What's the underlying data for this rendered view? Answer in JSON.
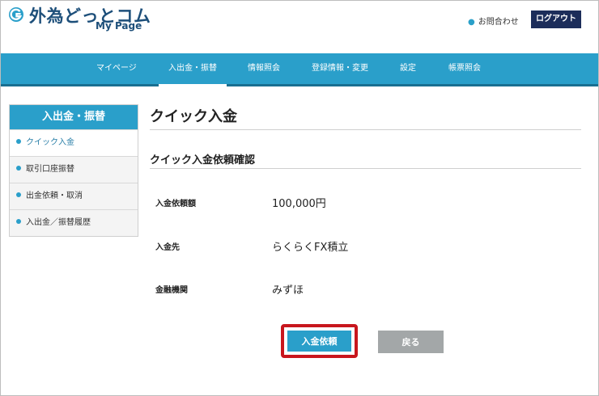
{
  "header": {
    "brand": "外為どっとコム",
    "brand_sub": "My Page",
    "contact_label": "お問合わせ",
    "logout_label": "ログアウト"
  },
  "nav": {
    "items": [
      {
        "label": "マイページ"
      },
      {
        "label": "入出金・振替",
        "active": true
      },
      {
        "label": "情報照会"
      },
      {
        "label": "登録情報・変更"
      },
      {
        "label": "設定"
      },
      {
        "label": "帳票照会"
      }
    ]
  },
  "sidebar": {
    "title": "入出金・振替",
    "items": [
      {
        "label": "クイック入金",
        "active": true
      },
      {
        "label": "取引口座振替"
      },
      {
        "label": "出金依頼・取消"
      },
      {
        "label": "入出金／振替履歴"
      }
    ]
  },
  "main": {
    "title": "クイック入金",
    "section_title": "クイック入金依頼確認",
    "rows": [
      {
        "label": "入金依頼額",
        "value": "100,000円"
      },
      {
        "label": "入金先",
        "value": "らくらくFX積立"
      },
      {
        "label": "金融機関",
        "value": "みずほ"
      }
    ],
    "submit_label": "入金依頼",
    "back_label": "戻る"
  },
  "colors": {
    "accent": "#2a9fca",
    "logout_bg": "#1c2d5a",
    "highlight_border": "#c8161d",
    "back_bg": "#a3a7a8"
  }
}
